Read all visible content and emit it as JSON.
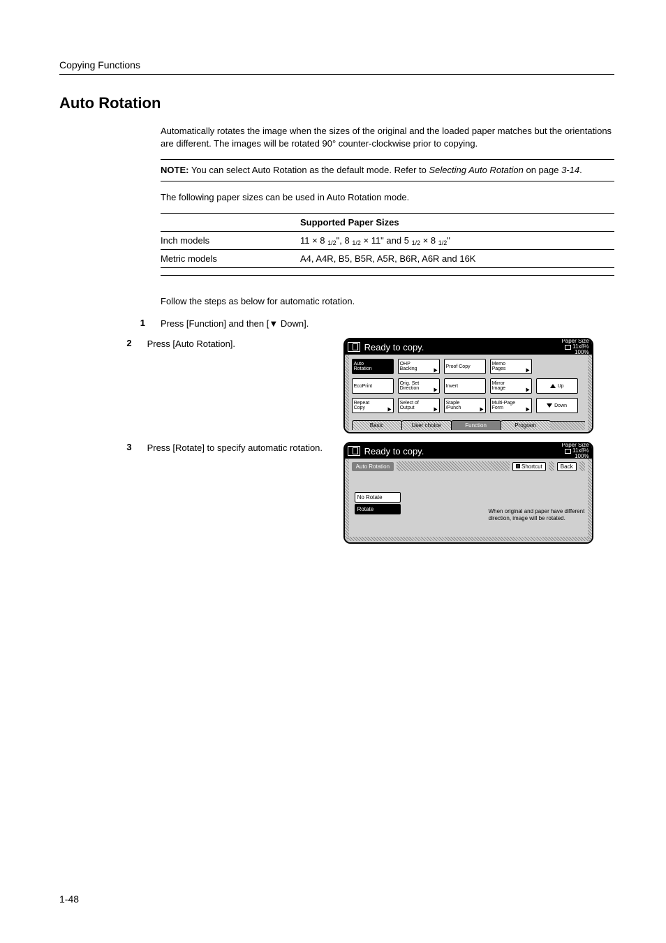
{
  "header": {
    "running": "Copying Functions"
  },
  "title": "Auto Rotation",
  "intro": "Automatically rotates the image when the sizes of the original and the loaded paper matches but the orientations are different. The images will be rotated 90° counter-clockwise prior to copying.",
  "note": {
    "label": "NOTE:",
    "before_ref": " You can select Auto Rotation as the default mode. Refer to ",
    "ref": "Selecting Auto Rotation",
    "after_ref": " on page ",
    "page_ref": "3-14",
    "end": "."
  },
  "sizes_intro": "The following paper sizes can be used in Auto Rotation mode.",
  "sizes_table": {
    "col1": "",
    "col2": "Supported Paper Sizes",
    "rows": [
      {
        "model": "Inch models",
        "sizes_html": true,
        "a": "11 × 8 ",
        "a2": "1/2",
        "b": "\", 8 ",
        "b2": "1/2",
        "c": " × 11\" and 5 ",
        "c2": "1/2",
        "d": " × 8 ",
        "d2": "1/2",
        "e": "\""
      },
      {
        "model": "Metric models",
        "sizes": "A4, A4R, B5, B5R, A5R, B6R, A6R and 16K"
      }
    ]
  },
  "follow": "Follow the steps as below for automatic rotation.",
  "steps": {
    "s1": {
      "num": "1",
      "text": "Press [Function] and then [▼ Down]."
    },
    "s2": {
      "num": "2",
      "text": "Press [Auto Rotation]."
    },
    "s3": {
      "num": "3",
      "text": "Press [Rotate] to specify automatic rotation."
    }
  },
  "lcd_common": {
    "title": "Ready to copy.",
    "paper_label": "Paper Size",
    "paper_size": "11x8½",
    "zoom": "100%"
  },
  "lcd1": {
    "grid": {
      "c1": [
        "Auto\nRotation",
        "EcoPrint",
        "Repeat\nCopy"
      ],
      "c2": [
        "OHP\nBacking",
        "Orig. Set\nDirection",
        "Select of\nOutput"
      ],
      "c3": [
        "Proof Copy",
        "Invert",
        "Staple\n/Punch"
      ],
      "c4": [
        "Memo\nPages",
        "Mirror\nImage",
        "Multi-Page\nForm"
      ],
      "nav": [
        "",
        "Up",
        "Down"
      ]
    },
    "tabs": [
      "Basic",
      "User choice",
      "Function",
      "Program"
    ]
  },
  "lcd2": {
    "sub_name": "Auto Rotation",
    "shortcut": "Shortcut",
    "back": "Back",
    "options": [
      "No Rotate",
      "Rotate"
    ],
    "hint1": "When original and paper have different",
    "hint2": "direction, image will be rotated."
  },
  "page_number": "1-48"
}
